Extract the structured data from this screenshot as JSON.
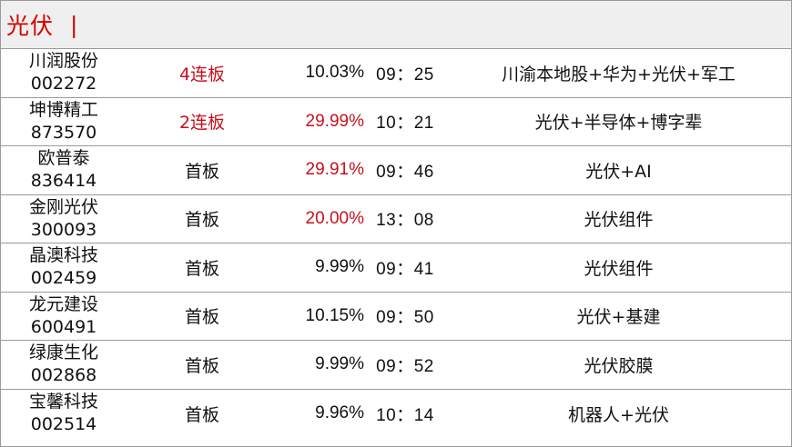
{
  "header": {
    "title": "光伏",
    "cursor": "|"
  },
  "colors": {
    "accent_red": "#c8101e",
    "header_bg": "#efefef"
  },
  "rows": [
    {
      "name": "川润股份",
      "code": "002272",
      "board": "4连板",
      "pct": "10.03%",
      "time": "09：25",
      "tags": "川渝本地股+华为+光伏+军工",
      "board_red": true,
      "pct_red": false
    },
    {
      "name": "坤博精工",
      "code": "873570",
      "board": "2连板",
      "pct": "29.99%",
      "time": "10：21",
      "tags": "光伏+半导体+博字辈",
      "board_red": true,
      "pct_red": true
    },
    {
      "name": "欧普泰",
      "code": "836414",
      "board": "首板",
      "pct": "29.91%",
      "time": "09：46",
      "tags": "光伏+AI",
      "board_red": false,
      "pct_red": true
    },
    {
      "name": "金刚光伏",
      "code": "300093",
      "board": "首板",
      "pct": "20.00%",
      "time": "13：08",
      "tags": "光伏组件",
      "board_red": false,
      "pct_red": true
    },
    {
      "name": "晶澳科技",
      "code": "002459",
      "board": "首板",
      "pct": "9.99%",
      "time": "09：41",
      "tags": "光伏组件",
      "board_red": false,
      "pct_red": false
    },
    {
      "name": "龙元建设",
      "code": "600491",
      "board": "首板",
      "pct": "10.15%",
      "time": "09：50",
      "tags": "光伏+基建",
      "board_red": false,
      "pct_red": false
    },
    {
      "name": "绿康生化",
      "code": "002868",
      "board": "首板",
      "pct": "9.99%",
      "time": "09：52",
      "tags": "光伏胶膜",
      "board_red": false,
      "pct_red": false
    },
    {
      "name": "宝馨科技",
      "code": "002514",
      "board": "首板",
      "pct": "9.96%",
      "time": "10：14",
      "tags": "机器人+光伏",
      "board_red": false,
      "pct_red": false
    }
  ]
}
